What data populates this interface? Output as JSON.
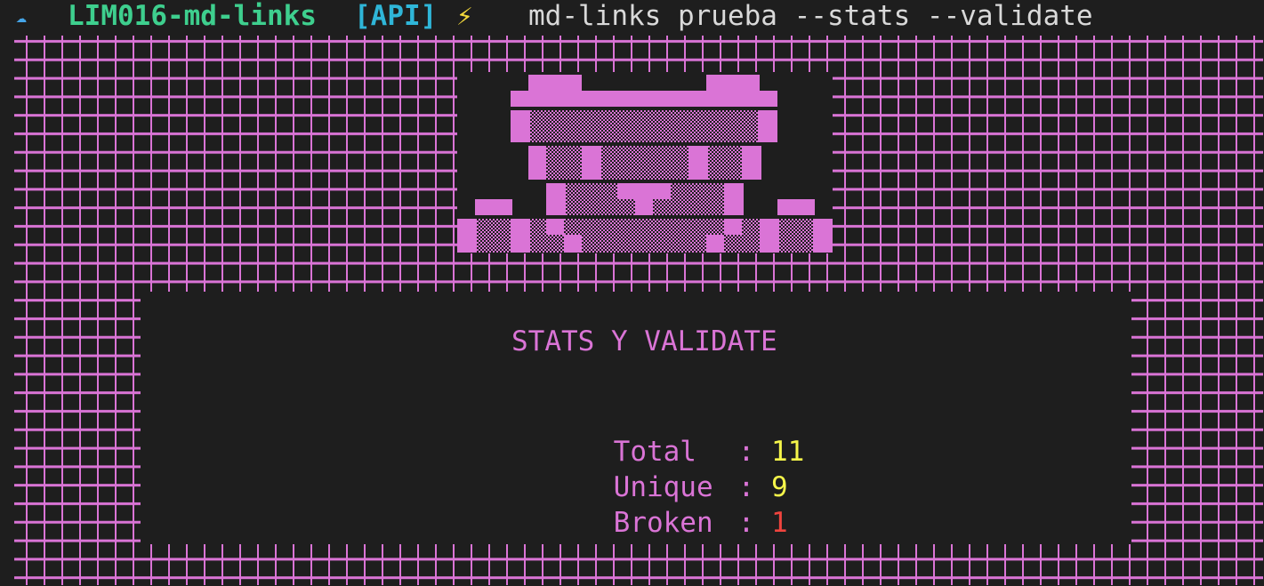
{
  "prompt": {
    "icon": "cloud-icon",
    "directory": "LIM016-md-links",
    "branch": "[API]",
    "bolt": "⚡",
    "command": "md-links prueba --stats --validate"
  },
  "stats": {
    "title": "STATS Y VALIDATE",
    "separator": ":",
    "rows": [
      {
        "label": "Total",
        "value": "11",
        "color": "#f5f54a"
      },
      {
        "label": "Unique",
        "value": "9",
        "color": "#f5f54a"
      },
      {
        "label": "Broken",
        "value": "1",
        "color": "#f0443e"
      }
    ]
  },
  "colors": {
    "background": "#1e1e1e",
    "grid": "#da74d6",
    "directory": "#3ecf8e",
    "branch": "#2fb6d8",
    "command": "#d9d9d9"
  }
}
